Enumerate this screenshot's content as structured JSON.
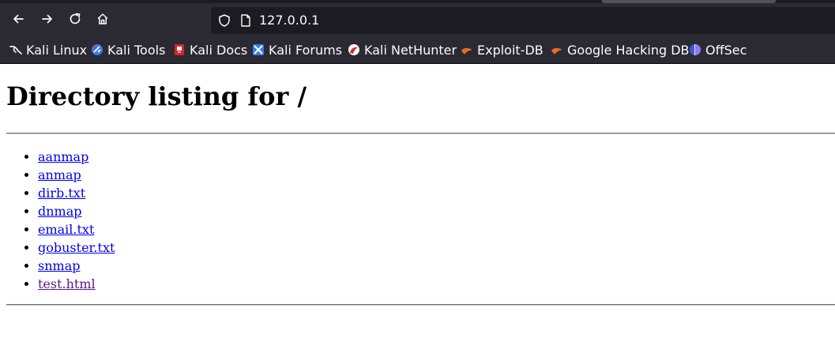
{
  "browser": {
    "url": "127.0.0.1",
    "bookmarks": [
      {
        "label": "Kali Linux",
        "icon": "kali-dragon-icon"
      },
      {
        "label": "Kali Tools",
        "icon": "kali-tools-icon"
      },
      {
        "label": "Kali Docs",
        "icon": "kali-docs-icon"
      },
      {
        "label": "Kali Forums",
        "icon": "kali-forums-icon"
      },
      {
        "label": "Kali NetHunter",
        "icon": "kali-nethunter-icon"
      },
      {
        "label": "Exploit-DB",
        "icon": "exploit-db-icon"
      },
      {
        "label": "Google Hacking DB",
        "icon": "google-hacking-db-icon"
      },
      {
        "label": "OffSec",
        "icon": "offsec-icon"
      }
    ]
  },
  "page": {
    "title": "Directory listing for /",
    "files": [
      {
        "name": "aanmap",
        "visited": false
      },
      {
        "name": "anmap",
        "visited": false
      },
      {
        "name": "dirb.txt",
        "visited": false
      },
      {
        "name": "dnmap",
        "visited": false
      },
      {
        "name": "email.txt",
        "visited": false
      },
      {
        "name": "gobuster.txt",
        "visited": false
      },
      {
        "name": "snmap",
        "visited": false
      },
      {
        "name": "test.html",
        "visited": true
      }
    ]
  },
  "colors": {
    "toolbar": "#2b2a33",
    "urlbar": "#1c1b22",
    "link": "#0000ee",
    "visited_link": "#551a8b"
  }
}
